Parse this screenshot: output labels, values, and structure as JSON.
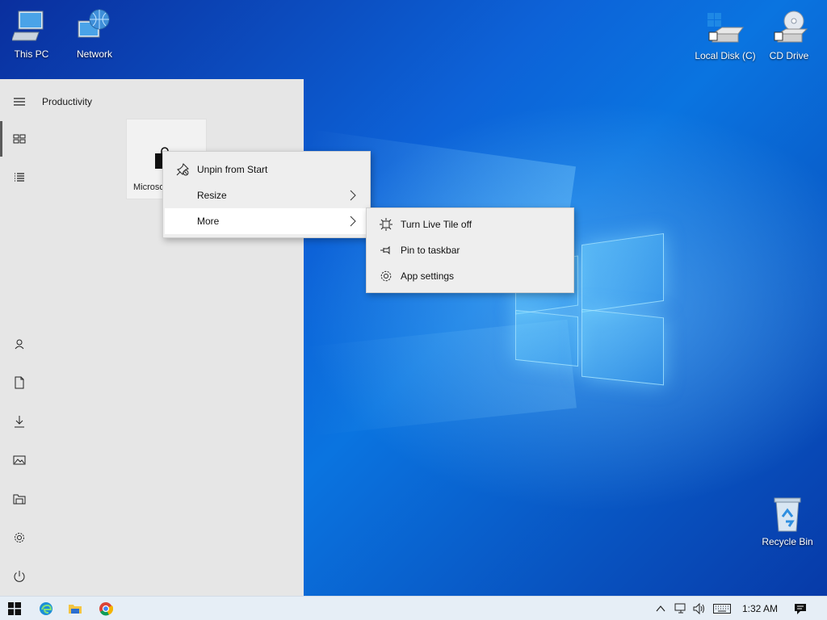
{
  "desktop": {
    "icons": [
      {
        "label": "This PC"
      },
      {
        "label": "Network"
      },
      {
        "label": "Local Disk (C)"
      },
      {
        "label": "CD Drive"
      },
      {
        "label": "Recycle Bin"
      }
    ]
  },
  "start_menu": {
    "group_title": "Productivity",
    "tile": {
      "label": "Microsoft Store"
    },
    "rail": [
      "menu-icon",
      "tiles-icon",
      "list-icon",
      "user-icon",
      "document-icon",
      "download-icon",
      "pictures-icon",
      "file-explorer-icon",
      "settings-icon",
      "power-icon"
    ]
  },
  "context_menu": {
    "items": [
      {
        "label": "Unpin from Start",
        "icon": "unpin-icon"
      },
      {
        "label": "Resize",
        "icon": "",
        "submenu": true
      },
      {
        "label": "More",
        "icon": "",
        "submenu": true,
        "hovered": true
      }
    ]
  },
  "submenu": {
    "items": [
      {
        "label": "Turn Live Tile off",
        "icon": "live-tile-icon"
      },
      {
        "label": "Pin to taskbar",
        "icon": "pin-icon"
      },
      {
        "label": "App settings",
        "icon": "gear-icon"
      }
    ]
  },
  "taskbar": {
    "clock": "1:32 AM",
    "apps": [
      "windows-start-icon",
      "edge-icon",
      "file-explorer-icon",
      "chrome-icon"
    ],
    "tray": [
      "chevron-up-icon",
      "network-icon",
      "volume-icon",
      "keyboard-icon",
      "notification-icon"
    ]
  },
  "colors": {
    "accent": "#0a63d8",
    "menu_bg": "#e6e6e6",
    "taskbar_bg": "#e6eef6"
  }
}
